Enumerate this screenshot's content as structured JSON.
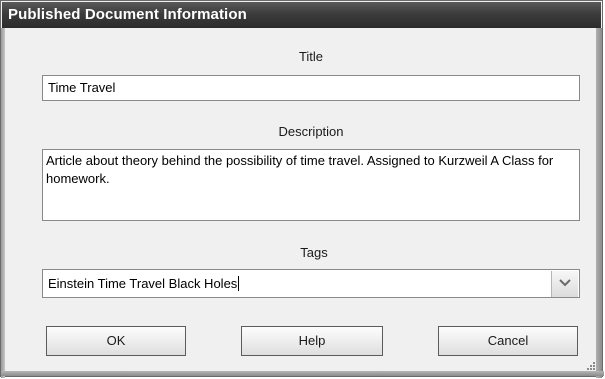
{
  "dialog": {
    "title": "Published Document Information"
  },
  "title_section": {
    "label": "Title",
    "value": "Time Travel"
  },
  "description_section": {
    "label": "Description",
    "value": "Article about theory behind the possibility of time travel. Assigned to Kurzweil A Class for homework."
  },
  "tags_section": {
    "label": "Tags",
    "value": "Einstein Time Travel Black Holes",
    "dropdown_icon": "chevron-down-icon"
  },
  "buttons": {
    "ok_label": "OK",
    "help_label": "Help",
    "cancel_label": "Cancel"
  }
}
